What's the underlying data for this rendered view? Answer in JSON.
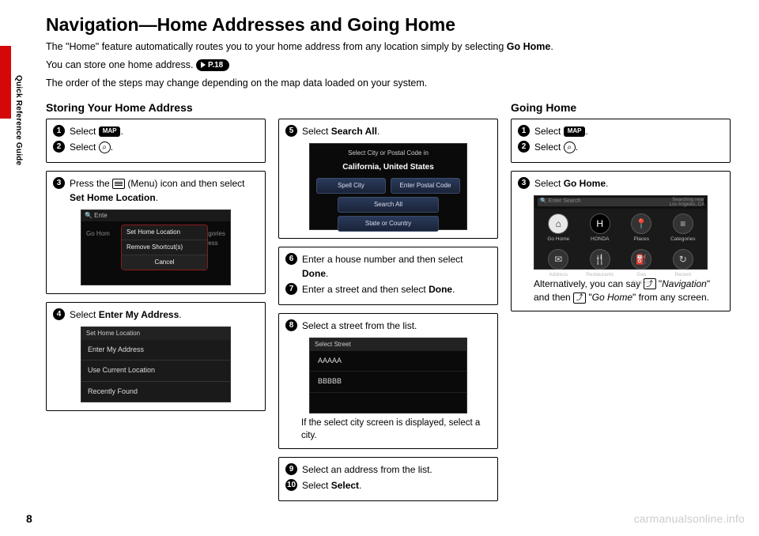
{
  "side_tab_label": "Quick Reference Guide",
  "page_number": "8",
  "watermark": "carmanualsonline.info",
  "title": "Navigation—Home Addresses and Going Home",
  "intro": {
    "line1_a": "The \"Home\" feature automatically routes you to your home address from any location simply by selecting ",
    "line1_b": "Go Home",
    "line1_c": ".",
    "line2_a": "You can store one home address. ",
    "pref": "P.18",
    "line3": "The order of the steps may change depending on the map data loaded on your system."
  },
  "icons": {
    "map_label": "MAP",
    "search_glyph": "⌕",
    "voice_glyph": "⤴"
  },
  "storing": {
    "heading": "Storing Your Home Address",
    "s1": "Select ",
    "s2": "Select ",
    "s3_a": "Press the ",
    "s3_b": " (Menu) icon and then select ",
    "s3_c": "Set Home Location",
    "s4_a": "Select ",
    "s4_b": "Enter My Address",
    "scr1": {
      "topbar": "🔍 Ente",
      "r1": "Set Home Location",
      "r2": "Remove Shortcut(s)",
      "r3": "Cancel",
      "left": "Go Hom",
      "right": "Categories\nAddress"
    },
    "scr2": {
      "hdr": "Set Home Location",
      "o1": "Enter My Address",
      "o2": "Use Current Location",
      "o3": "Recently Found"
    }
  },
  "mid": {
    "s5_a": "Select ",
    "s5_b": "Search All",
    "s6_a": "Enter a house number and then select ",
    "s6_b": "Done",
    "s7_a": "Enter a street and then select ",
    "s7_b": "Done",
    "s8": "Select a street from the list.",
    "s8_note": "If the select city screen is displayed, select a city.",
    "s9": "Select an address from the list.",
    "s10_a": "Select ",
    "s10_b": "Select",
    "scr3": {
      "t1": "Select City or Postal Code in",
      "t2": "California, United States",
      "p1": "Spell City",
      "p2": "Enter Postal Code",
      "p3": "Search All",
      "p4": "State or Country"
    },
    "scr4": {
      "hdr": "Select Street",
      "r1": "AAAAA",
      "r2": "BBBBB"
    }
  },
  "going": {
    "heading": "Going Home",
    "s1": "Select ",
    "s2": "Select ",
    "s3_a": "Select ",
    "s3_b": "Go Home",
    "note_a": "Alternatively, you can say ",
    "note_b": "\"",
    "note_c": "Navigation",
    "note_d": "\" and then ",
    "note_e": " \"",
    "note_f": "Go Home",
    "note_g": "\" from any screen.",
    "scr5": {
      "search": "🔍 Enter Search",
      "sidetxt": "Searching near\nLos Angeles, CA",
      "i1": "Go Home",
      "i2": "HONDA",
      "i3": "Places",
      "i4": "Categories",
      "i5": "Address",
      "i6": "Restaurants",
      "i7": "Gas Stations",
      "i8": "Recent"
    }
  }
}
